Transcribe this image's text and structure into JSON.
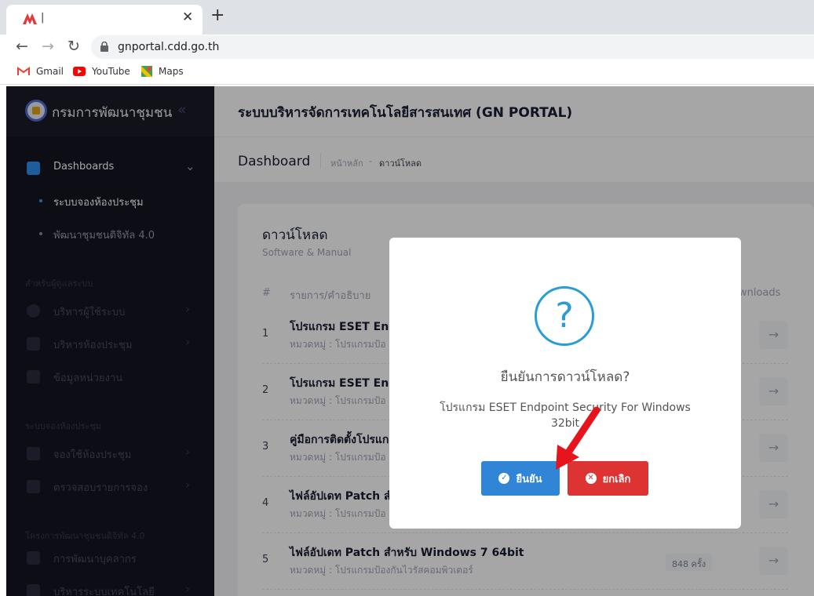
{
  "browser": {
    "tab_title": "|",
    "url": "gnportal.cdd.go.th",
    "bookmarks": [
      {
        "label": "Gmail",
        "icon": "gmail-icon"
      },
      {
        "label": "YouTube",
        "icon": "youtube-icon"
      },
      {
        "label": "Maps",
        "icon": "maps-icon"
      }
    ]
  },
  "sidebar": {
    "brand": "กรมการพัฒนาชุมชน",
    "dashboards": "Dashboards",
    "sub_items": [
      "ระบบจองห้องประชุม",
      "พัฒนาชุมชนดิจิทัล 4.0"
    ],
    "section_admin": "สำหรับผู้ดูแลระบบ",
    "admin_items": [
      "บริหารผู้ใช้ระบบ",
      "บริหารห้องประชุม",
      "ข้อมูลหน่วยงาน"
    ],
    "section_booking": "ระบบจองห้องประชุม",
    "booking_items": [
      "จองใช้ห้องประชุม",
      "ตรวจสอบรายการจอง"
    ],
    "section_digital": "โครงการพัฒนาชุมชนดิจิทัล 4.0",
    "digital_items": [
      "การพัฒนาบุคลากร",
      "บริหารระบบเทคโนโลยี"
    ]
  },
  "header": {
    "title": "ระบบบริหารจัดการเทคโนโลยีสารสนเทศ (GN PORTAL)",
    "page_title": "Dashboard",
    "breadcrumb_home": "หน้าหลัก",
    "breadcrumb_sep": "-",
    "breadcrumb_current": "ดาวน์โหลด"
  },
  "card": {
    "title": "ดาวน์โหลด",
    "subtitle": "Software & Manual",
    "col_num": "#",
    "col_name": "รายการ/คำอธิบาย",
    "col_downloads": "Downloads",
    "rows": [
      {
        "num": "1",
        "name": "โปรแกรม ESET Endp",
        "cat": "หมวดหมู่ : โปรแกรมป้อ"
      },
      {
        "num": "2",
        "name": "โปรแกรม ESET Endp",
        "cat": "หมวดหมู่ : โปรแกรมป้อ"
      },
      {
        "num": "3",
        "name": "คู่มือการติดตั้งโปรแก",
        "cat": "หมวดหมู่ : โปรแกรมป้อ"
      },
      {
        "num": "4",
        "name": "ไฟล์อัปเดท Patch สำ",
        "cat": "หมวดหมู่ : โปรแกรมป้อ"
      },
      {
        "num": "5",
        "name": "ไฟล์อัปเดท Patch สำหรับ Windows 7 64bit",
        "cat": "หมวดหมู่ : โปรแกรมป้องกันไวรัสคอมพิวเตอร์",
        "count": "848 ครั้ง"
      }
    ]
  },
  "modal": {
    "icon": "?",
    "title": "ยืนยันการดาวน์โหลด?",
    "text": "โปรแกรม ESET Endpoint Security For Windows 32bit",
    "confirm": "ยืนยัน",
    "cancel": "ยกเลิก"
  },
  "colors": {
    "confirm": "#3085d6",
    "cancel": "#dd3333",
    "question": "#2a9dd6",
    "sidebar": "#151521",
    "annotation_arrow": "#e8141c"
  }
}
